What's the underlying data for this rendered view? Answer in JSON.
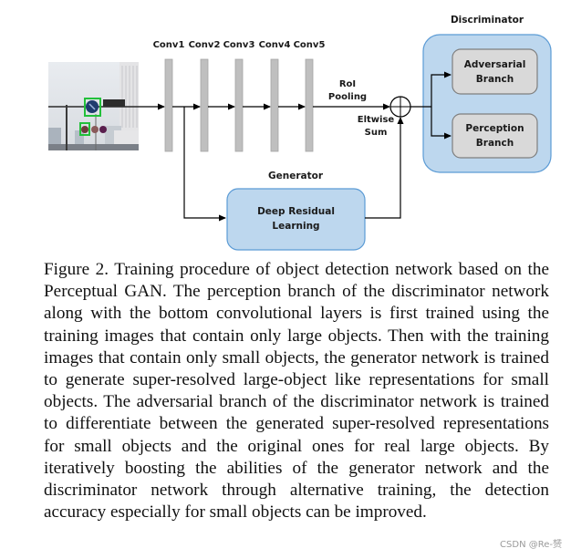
{
  "diagram": {
    "conv_layers": [
      "Conv1",
      "Conv2",
      "Conv3",
      "Conv4",
      "Conv5"
    ],
    "roi_pooling_label": [
      "RoI",
      "Pooling"
    ],
    "eltwise_label": [
      "Eltwise",
      "Sum"
    ],
    "generator": {
      "title": "Generator",
      "box_label": [
        "Deep Residual",
        "Learning"
      ]
    },
    "discriminator": {
      "title": "Discriminator",
      "branches": [
        {
          "label": [
            "Adversarial",
            "Branch"
          ]
        },
        {
          "label": [
            "Perception",
            "Branch"
          ]
        }
      ]
    },
    "input_image": {
      "description": "street scene with traffic signs and green detection boxes"
    },
    "colors": {
      "conv_bar": "#bfbfbf",
      "container_fill": "#bdd7ee",
      "container_stroke": "#5b9bd5",
      "branch_fill": "#d9d9d9",
      "branch_stroke": "#7f7f7f",
      "detection_box": "#22c03a"
    }
  },
  "caption": {
    "text": "Figure 2. Training procedure of object detection network based on the Perceptual GAN. The perception branch of the discriminator network along with the bottom convolutional layers is first trained using the training images that contain only large objects.  Then with the training images that contain only small objects, the generator network is trained to generate super-resolved large-object like representations for small objects.  The adversarial branch of the discriminator network is trained to differentiate between the generated super-resolved representations for small objects and the original ones for real large objects.  By iteratively boosting the abilities of the generator network and the discriminator network through alternative training, the detection accuracy especially for small objects can be improved."
  },
  "watermark": "CSDN @Re-赟"
}
